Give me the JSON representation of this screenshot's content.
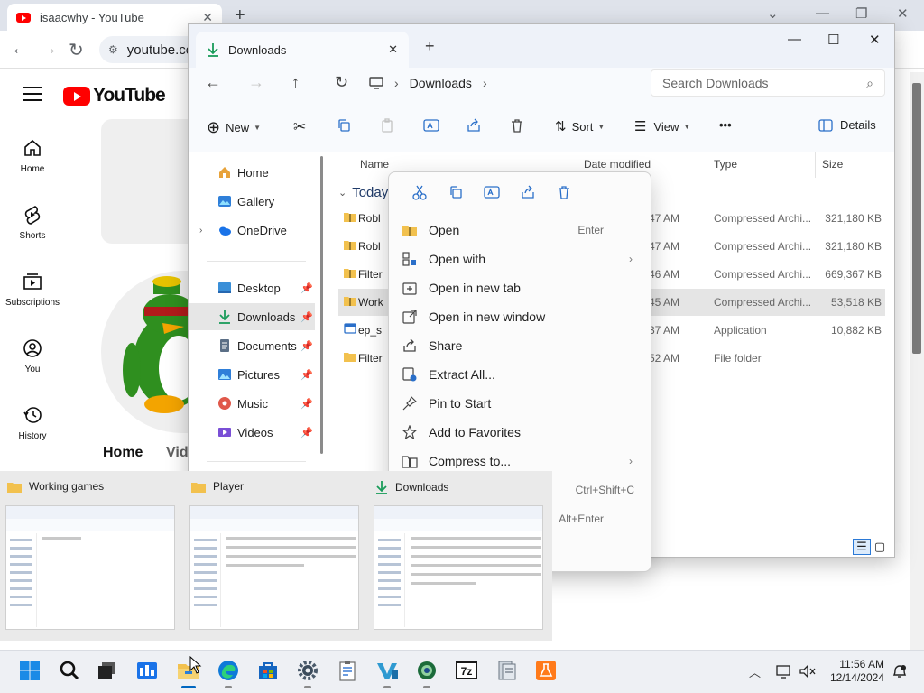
{
  "browser": {
    "tab_title": "isaacwhy - YouTube",
    "url": "youtube.co",
    "brand_word": "YouTube",
    "nav": [
      {
        "label": "Home"
      },
      {
        "label": "Shorts"
      },
      {
        "label": "Subscriptions"
      },
      {
        "label": "You"
      },
      {
        "label": "History"
      }
    ],
    "channel_tabs": {
      "home": "Home",
      "videos": "Vid"
    },
    "colors": {
      "brand_red": "#ff0000"
    }
  },
  "explorer": {
    "tab_title": "Downloads",
    "breadcrumb": "Downloads",
    "search_placeholder": "Search Downloads",
    "toolbar": {
      "new": "New",
      "sort": "Sort",
      "view": "View",
      "more": "•••",
      "details": "Details"
    },
    "sidebar": [
      {
        "label": "Home",
        "icon": "home-icon"
      },
      {
        "label": "Gallery",
        "icon": "gallery-icon"
      },
      {
        "label": "OneDrive",
        "icon": "cloud-icon"
      },
      {
        "label": "Desktop",
        "icon": "desktop-icon"
      },
      {
        "label": "Downloads",
        "icon": "download-icon"
      },
      {
        "label": "Documents",
        "icon": "documents-icon"
      },
      {
        "label": "Pictures",
        "icon": "pictures-icon"
      },
      {
        "label": "Music",
        "icon": "music-icon"
      },
      {
        "label": "Videos",
        "icon": "videos-icon"
      }
    ],
    "columns": {
      "name": "Name",
      "date": "Date modified",
      "type": "Type",
      "size": "Size"
    },
    "group": "Today",
    "files": [
      {
        "name": "Robl",
        "date": "47 AM",
        "type": "Compressed Archi...",
        "size": "321,180 KB",
        "icon": "zip-folder-icon"
      },
      {
        "name": "Robl",
        "date": "47 AM",
        "type": "Compressed Archi...",
        "size": "321,180 KB",
        "icon": "zip-folder-icon"
      },
      {
        "name": "Filter",
        "date": "46 AM",
        "type": "Compressed Archi...",
        "size": "669,367 KB",
        "icon": "zip-folder-icon"
      },
      {
        "name": "Work",
        "date": "45 AM",
        "type": "Compressed Archi...",
        "size": "53,518 KB",
        "icon": "zip-folder-icon"
      },
      {
        "name": "ep_s",
        "date": "37 AM",
        "type": "Application",
        "size": "10,882 KB",
        "icon": "application-icon"
      },
      {
        "name": "Filter",
        "date": "52 AM",
        "type": "File folder",
        "size": "",
        "icon": "folder-icon"
      }
    ]
  },
  "context_menu": {
    "items": [
      {
        "label": "Open",
        "shortcut": "Enter",
        "icon": "folder-open-icon"
      },
      {
        "label": "Open with",
        "shortcut": "",
        "icon": "open-with-icon"
      },
      {
        "label": "Open in new tab",
        "shortcut": "",
        "icon": "new-tab-icon"
      },
      {
        "label": "Open in new window",
        "shortcut": "",
        "icon": "new-window-icon"
      },
      {
        "label": "Share",
        "shortcut": "",
        "icon": "share-icon"
      },
      {
        "label": "Extract All...",
        "shortcut": "",
        "icon": "extract-icon"
      },
      {
        "label": "Pin to Start",
        "shortcut": "",
        "icon": "pin-icon"
      },
      {
        "label": "Add to Favorites",
        "shortcut": "",
        "icon": "star-icon"
      },
      {
        "label": "Compress to...",
        "shortcut": "",
        "icon": "compress-icon"
      },
      {
        "label": "",
        "shortcut": "Ctrl+Shift+C",
        "icon": ""
      },
      {
        "label": "",
        "shortcut": "Alt+Enter",
        "icon": ""
      }
    ]
  },
  "thumbnails": [
    {
      "label": "Working games"
    },
    {
      "label": "Player"
    },
    {
      "label": "Downloads"
    }
  ],
  "taskbar": {
    "time": "11:56 AM",
    "date": "12/14/2024"
  }
}
